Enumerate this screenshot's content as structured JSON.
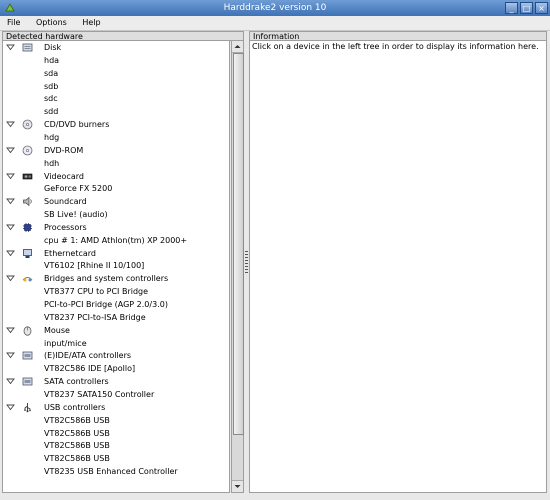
{
  "window": {
    "title": "Harddrake2 version 10"
  },
  "menu": {
    "file": "File",
    "options": "Options",
    "help": "Help"
  },
  "left_pane": {
    "header": "Detected hardware"
  },
  "right_pane": {
    "header": "Information",
    "placeholder": "Click on a device in the left tree in order to display its information here."
  },
  "tree": [
    {
      "label": "Disk",
      "icon": "disk-icon",
      "devices": [
        "hda",
        "sda",
        "sdb",
        "sdc",
        "sdd"
      ]
    },
    {
      "label": "CD/DVD burners",
      "icon": "cdrom-icon",
      "devices": [
        "hdg"
      ]
    },
    {
      "label": "DVD-ROM",
      "icon": "dvd-icon",
      "devices": [
        "hdh"
      ]
    },
    {
      "label": "Videocard",
      "icon": "videocard-icon",
      "devices": [
        "GeForce FX 5200"
      ]
    },
    {
      "label": "Soundcard",
      "icon": "speaker-icon",
      "devices": [
        "SB Live! (audio)"
      ]
    },
    {
      "label": "Processors",
      "icon": "cpu-icon",
      "devices": [
        "cpu # 1: AMD Athlon(tm) XP 2000+"
      ]
    },
    {
      "label": "Ethernetcard",
      "icon": "network-icon",
      "devices": [
        "VT6102 [Rhine II 10/100]"
      ]
    },
    {
      "label": "Bridges and system controllers",
      "icon": "bridge-icon",
      "devices": [
        "VT8377 CPU to PCI Bridge",
        "PCI-to-PCI Bridge (AGP 2.0/3.0)",
        "VT8237 PCI-to-ISA Bridge"
      ]
    },
    {
      "label": "Mouse",
      "icon": "mouse-icon",
      "devices": [
        "input/mice"
      ]
    },
    {
      "label": "(E)IDE/ATA controllers",
      "icon": "controller-icon",
      "devices": [
        "VT82C586 IDE [Apollo]"
      ]
    },
    {
      "label": "SATA controllers",
      "icon": "controller-icon",
      "devices": [
        "VT8237 SATA150 Controller"
      ]
    },
    {
      "label": "USB controllers",
      "icon": "usb-icon",
      "devices": [
        "VT82C586B USB",
        "VT82C586B USB",
        "VT82C586B USB",
        "VT82C586B USB",
        "VT8235 USB Enhanced Controller"
      ]
    }
  ]
}
